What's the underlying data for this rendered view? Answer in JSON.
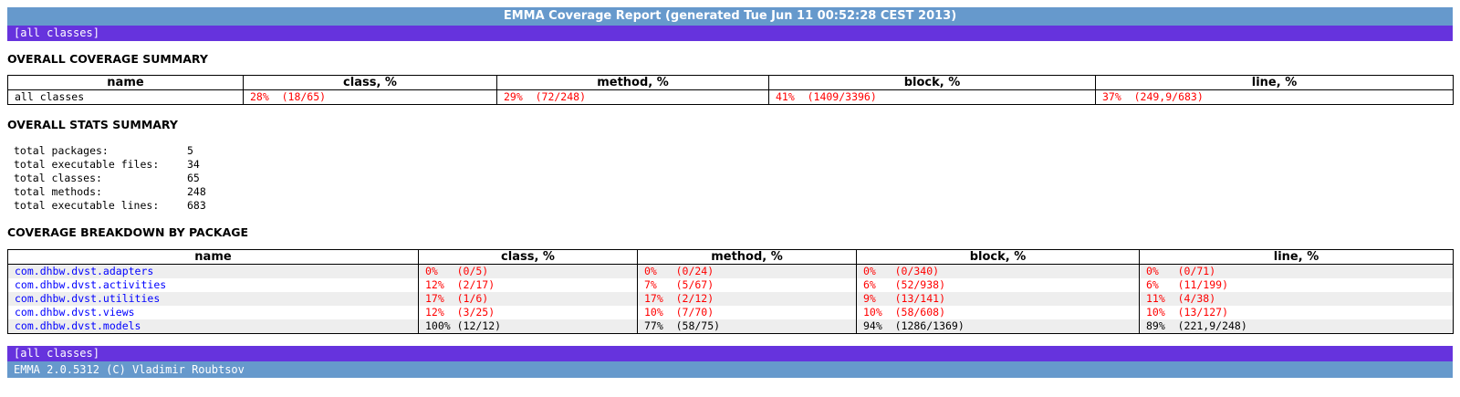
{
  "header": {
    "title": "EMMA Coverage Report (generated Tue Jun 11 00:52:28 CEST 2013)",
    "nav_link": "[all classes]"
  },
  "overall_coverage": {
    "heading": "OVERALL COVERAGE SUMMARY",
    "columns": [
      "name",
      "class, %",
      "method, %",
      "block, %",
      "line, %"
    ],
    "row": {
      "name": "all classes",
      "class": "28%  (18/65)",
      "method": "29%  (72/248)",
      "block": "41%  (1409/3396)",
      "line": "37%  (249,9/683)"
    }
  },
  "overall_stats": {
    "heading": "OVERALL STATS SUMMARY",
    "items": [
      {
        "label": "total packages:",
        "value": "5"
      },
      {
        "label": "total executable files:",
        "value": "34"
      },
      {
        "label": "total classes:",
        "value": "65"
      },
      {
        "label": "total methods:",
        "value": "248"
      },
      {
        "label": "total executable lines:",
        "value": "683"
      }
    ]
  },
  "package_breakdown": {
    "heading": "COVERAGE BREAKDOWN BY PACKAGE",
    "columns": [
      "name",
      "class, %",
      "method, %",
      "block, %",
      "line, %"
    ],
    "rows": [
      {
        "name": "com.dhbw.dvst.adapters",
        "class": "0%   (0/5)",
        "method": "0%   (0/24)",
        "block": "0%   (0/340)",
        "line": "0%   (0/71)"
      },
      {
        "name": "com.dhbw.dvst.activities",
        "class": "12%  (2/17)",
        "method": "7%   (5/67)",
        "block": "6%   (52/938)",
        "line": "6%   (11/199)"
      },
      {
        "name": "com.dhbw.dvst.utilities",
        "class": "17%  (1/6)",
        "method": "17%  (2/12)",
        "block": "9%   (13/141)",
        "line": "11%  (4/38)"
      },
      {
        "name": "com.dhbw.dvst.views",
        "class": "12%  (3/25)",
        "method": "10%  (7/70)",
        "block": "10%  (58/608)",
        "line": "10%  (13/127)"
      },
      {
        "name": "com.dhbw.dvst.models",
        "class": "100% (12/12)",
        "method": "77%  (58/75)",
        "block": "94%  (1286/1369)",
        "line": "89%  (221,9/248)"
      }
    ]
  },
  "footer": {
    "nav_link": "[all classes]",
    "credit": "EMMA 2.0.5312 (C) Vladimir Roubtsov"
  },
  "colors": {
    "title_bar": "#6699cc",
    "nav_bar": "#6633dd",
    "low_coverage": "#ff0000",
    "link": "#0000ff"
  }
}
